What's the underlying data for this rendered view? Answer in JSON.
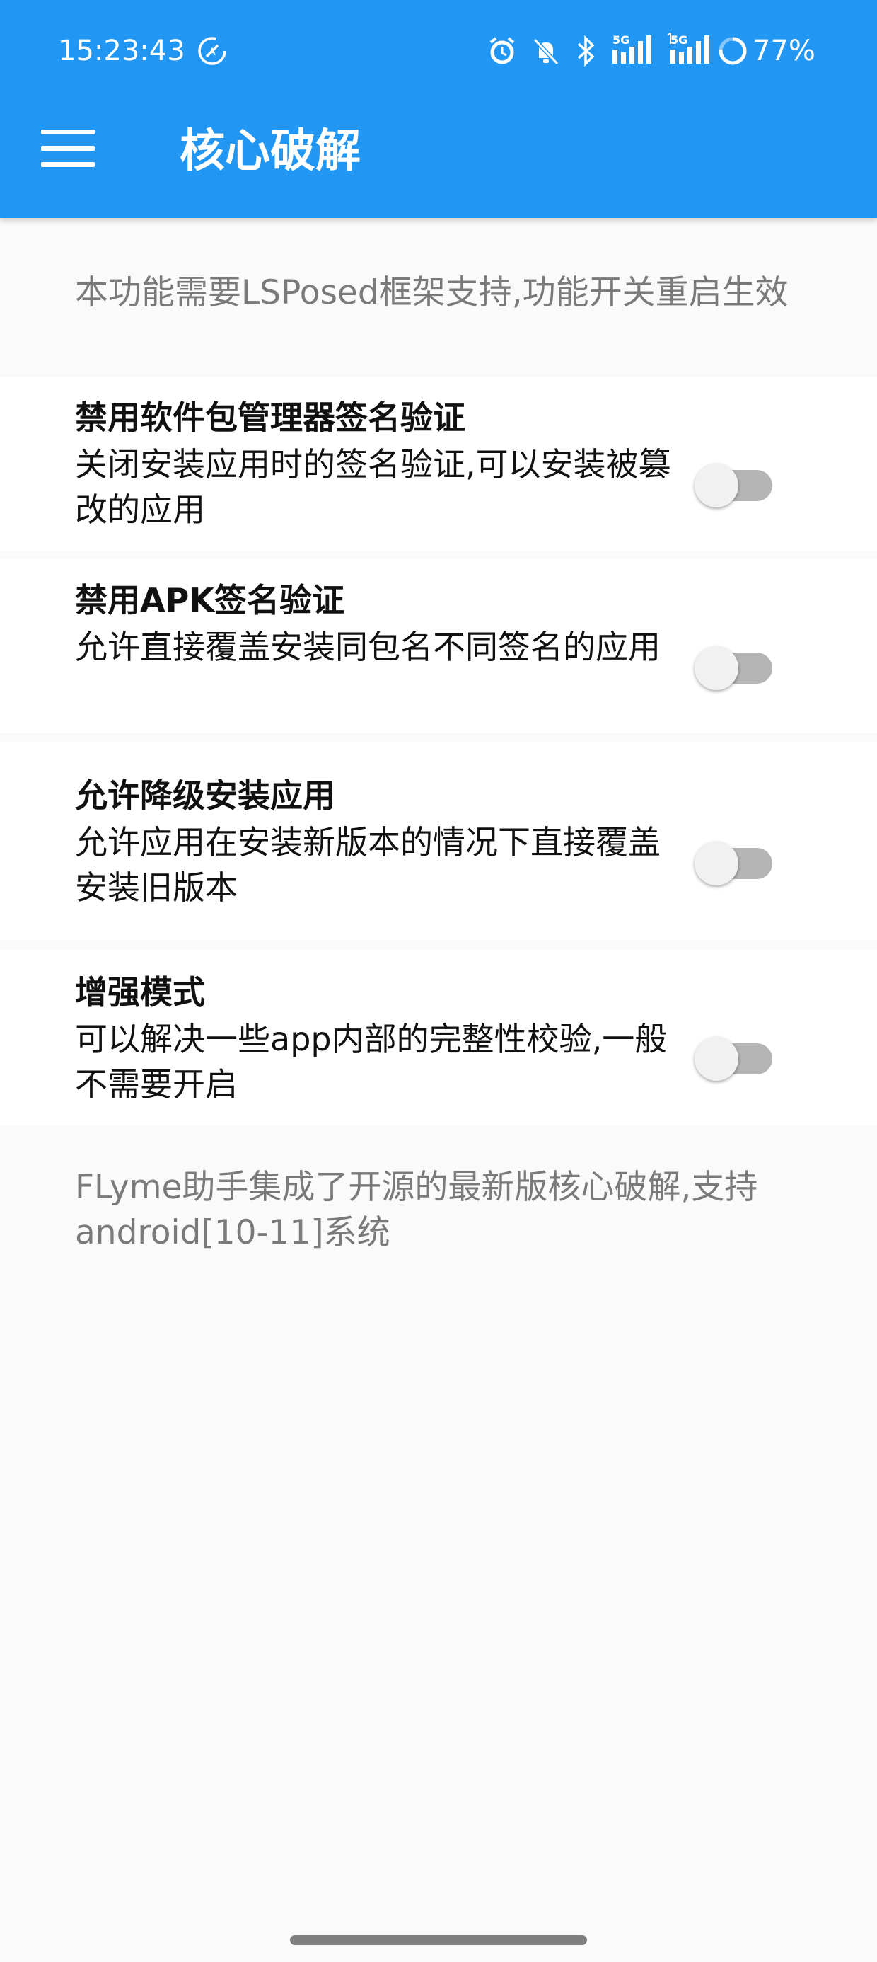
{
  "status_bar": {
    "time": "15:23:43",
    "battery": "77%",
    "icons": [
      "data-saver-icon",
      "alarm-icon",
      "mute-icon",
      "bluetooth-icon",
      "signal-5g-icon",
      "signal-5g-icon-2",
      "battery-ring-icon"
    ]
  },
  "app_bar": {
    "title": "核心破解",
    "menu_icon": "menu-icon",
    "color": "#2196f3"
  },
  "header_note": "本功能需要LSPosed框架支持,功能开关重启生效",
  "settings": [
    {
      "title": "禁用软件包管理器签名验证",
      "description": "关闭安装应用时的签名验证,可以安装被篡改的应用",
      "enabled": false
    },
    {
      "title": "禁用APK签名验证",
      "description": "允许直接覆盖安装同包名不同签名的应用",
      "enabled": false
    },
    {
      "title": "允许降级安装应用",
      "description": "允许应用在安装新版本的情况下直接覆盖安装旧版本",
      "enabled": false
    },
    {
      "title": "增强模式",
      "description": "可以解决一些app内部的完整性校验,一般不需要开启",
      "enabled": false
    }
  ],
  "footer_note": "FLyme助手集成了开源的最新版核心破解,支持android[10-11]系统"
}
